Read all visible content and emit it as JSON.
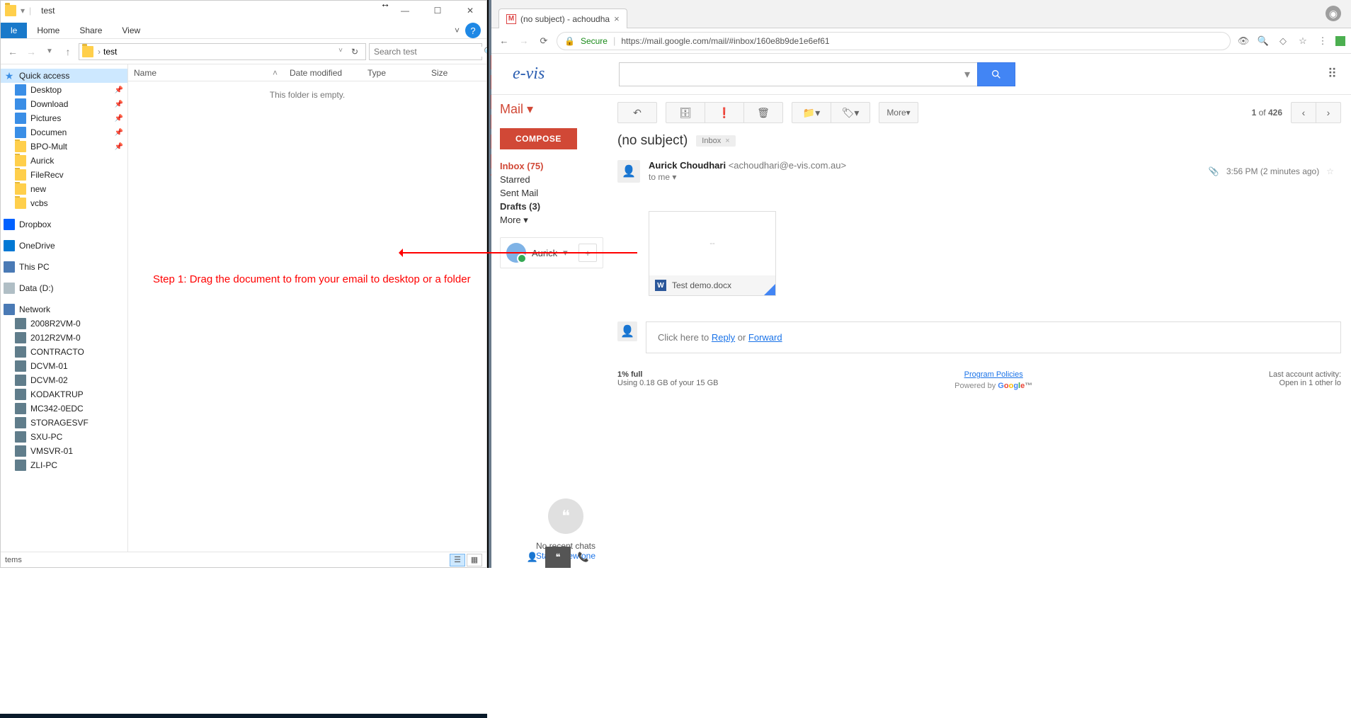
{
  "explorer": {
    "title_path": "test",
    "tabs": {
      "file": "le",
      "home": "Home",
      "share": "Share",
      "view": "View"
    },
    "address": {
      "crumb1": "test",
      "search_placeholder": "Search test"
    },
    "columns": {
      "name": "Name",
      "date": "Date modified",
      "type": "Type",
      "size": "Size"
    },
    "empty": "This folder is empty.",
    "status": "tems",
    "nav": {
      "quick_access": "Quick access",
      "pinned": [
        {
          "label": "Desktop"
        },
        {
          "label": "Download"
        },
        {
          "label": "Pictures"
        },
        {
          "label": "Documen"
        },
        {
          "label": "BPO-Mult"
        }
      ],
      "recent": [
        "Aurick",
        "FileRecv",
        "new",
        "vcbs"
      ],
      "dropbox": "Dropbox",
      "onedrive": "OneDrive",
      "thispc": "This PC",
      "drive": "Data (D:)",
      "network": "Network",
      "computers": [
        "2008R2VM-0",
        "2012R2VM-0",
        "CONTRACTO",
        "DCVM-01",
        "DCVM-02",
        "KODAKTRUP",
        "MC342-0EDC",
        "STORAGESVF",
        "SXU-PC",
        "VMSVR-01",
        "ZLI-PC"
      ]
    }
  },
  "chrome": {
    "tab_title": "(no subject) - achoudha",
    "url_secure": "Secure",
    "url": "https://mail.google.com/mail/#inbox/160e8b9de1e6ef61"
  },
  "gmail": {
    "logo": "e-vis",
    "mail_label": "Mail",
    "compose": "COMPOSE",
    "folders": {
      "inbox": "Inbox (75)",
      "starred": "Starred",
      "sent": "Sent Mail",
      "drafts": "Drafts (3)",
      "more": "More"
    },
    "hangout_name": "Aurick",
    "toolbar": {
      "more": "More"
    },
    "pager": {
      "pos": "1",
      "of": " of ",
      "total": "426"
    },
    "subject": "(no subject)",
    "label_chip": "Inbox",
    "from_name": "Aurick Choudhari",
    "from_email": " <achoudhari@e-vis.com.au>",
    "to": "to me",
    "timestamp": "3:56 PM (2 minutes ago)",
    "attach_preview": "--",
    "attach_name": "Test demo.docx",
    "reply_prefix": "Click here to ",
    "reply_reply": "Reply",
    "reply_or": " or ",
    "reply_fwd": "Forward",
    "footer": {
      "pct": "1% full",
      "usage": "Using 0.18 GB of your 15 GB",
      "policies": "Program Policies",
      "powered": "Powered by ",
      "activity": "Last account activity:",
      "open": "Open in 1 other lo"
    },
    "hangout_bottom": {
      "msg": "No recent chats",
      "link": "Start a new one"
    }
  },
  "annotation": "Step 1: Drag the document to from your email to desktop or a folder"
}
